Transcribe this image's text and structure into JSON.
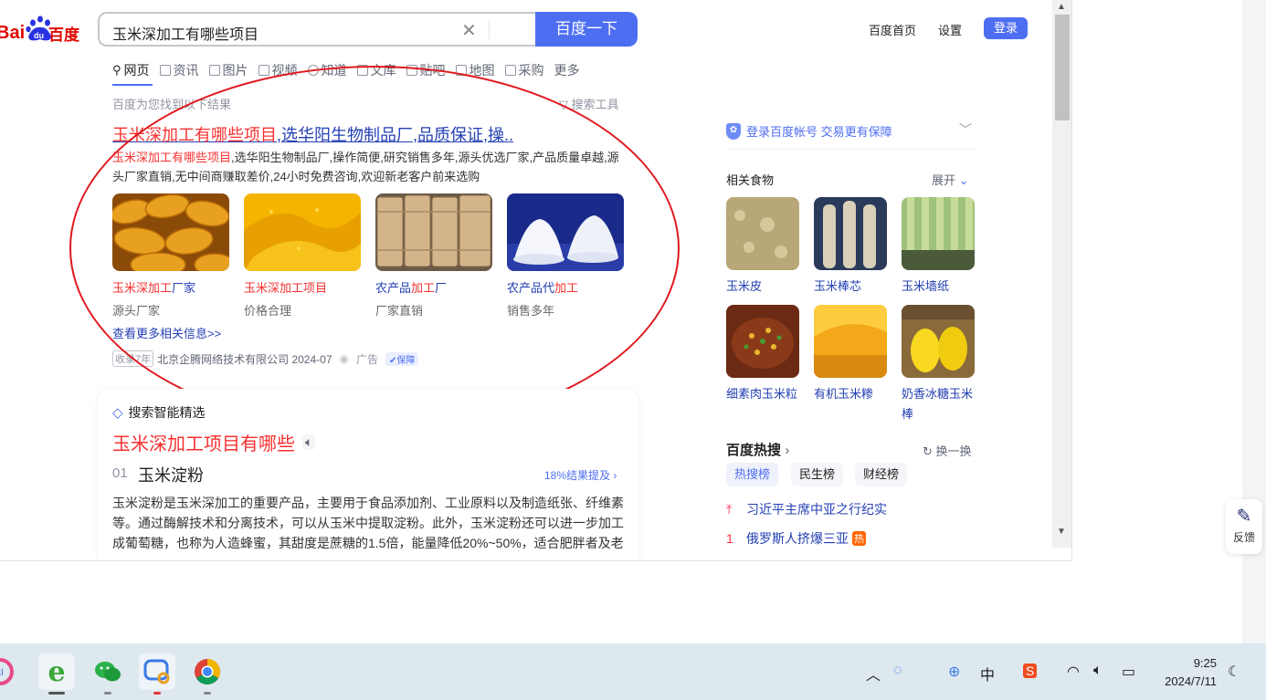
{
  "browser": {
    "search_query": "玉米深加工有哪些项目",
    "search_button": "百度一下",
    "top_links": {
      "home": "百度首页",
      "settings": "设置",
      "login": "登录"
    },
    "tabs": [
      "网页",
      "资讯",
      "图片",
      "视频",
      "知道",
      "文库",
      "贴吧",
      "地图",
      "采购",
      "更多"
    ],
    "result_count": "百度为您找到以下结果",
    "search_tools": "搜索工具"
  },
  "ad": {
    "title_hl": "玉米深加工有哪些项目",
    "title_rest": ",选华阳生物制品厂,品质保证,操..",
    "desc_hl": "玉米深加工有哪些项目",
    "desc_rest": ",选华阳生物制品厂,操作简便,研究销售多年,源头优选厂家,产品质量卓越,源头厂家直销,无中间商赚取差价,24小时免费咨询,欢迎新老客户前来选购",
    "cards": [
      {
        "cap_hl": "玉米深加工",
        "cap_rest": "厂家",
        "cap_pre": "",
        "sub": "源头厂家"
      },
      {
        "cap_hl": "玉米深加工项目",
        "cap_rest": "",
        "cap_pre": "",
        "sub": "价格合理"
      },
      {
        "cap_pre": "农产品",
        "cap_hl": "加工",
        "cap_rest": "厂",
        "sub": "厂家直销"
      },
      {
        "cap_pre": "农产品代",
        "cap_hl": "加工",
        "cap_rest": "",
        "sub": "销售多年"
      }
    ],
    "more_info": "查看更多相关信息>>",
    "meta_badge": "收录7年",
    "company": "北京企腾网络技术有限公司 2024-07",
    "ad_label": "广告",
    "guarantee": "保障"
  },
  "smart": {
    "label": "搜索智能精选",
    "title": "玉米深加工项目有哪些",
    "item_num": "01",
    "item_name": "玉米淀粉",
    "item_ratio": "18%结果提及",
    "item_desc": "玉米淀粉是玉米深加工的重要产品，主要用于食品添加剂、工业原料以及制造纸张、纤维素等。通过酶解技术和分离技术，可以从玉米中提取淀粉。此外，玉米淀粉还可以进一步加工成葡萄糖，也称为人造蜂蜜，其甜度是蔗糖的1.5倍，能量降低20%~50%，适合肥胖者及老"
  },
  "sidebar": {
    "login_tip": "登录百度帐号 交易更有保障",
    "related_title": "相关食物",
    "expand": "展开",
    "foods": [
      "玉米皮",
      "玉米棒芯",
      "玉米墙纸",
      "细素肉玉米粒",
      "有机玉米糁",
      "奶香冰糖玉米棒"
    ],
    "hot_title": "百度热搜",
    "refresh": "换一换",
    "hot_tabs": [
      "热搜榜",
      "民生榜",
      "财经榜"
    ],
    "hot_items": [
      {
        "rank": "",
        "text": "习近平主席中亚之行纪实",
        "badge": ""
      },
      {
        "rank": "1",
        "text": "俄罗斯人挤爆三亚",
        "badge": "热"
      }
    ]
  },
  "feedback": "反馈",
  "taskbar": {
    "time": "9:25",
    "date": "2024/7/11",
    "ime": "中"
  }
}
